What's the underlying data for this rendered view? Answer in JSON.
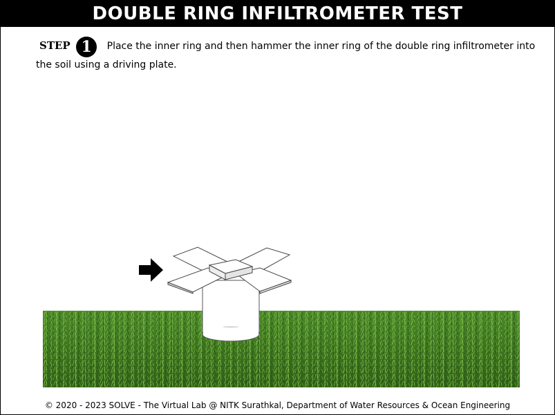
{
  "header": {
    "title": "DOUBLE RING INFILTROMETER TEST"
  },
  "step": {
    "label": "STEP",
    "number": "1",
    "text": "Place the inner ring and then hammer the inner ring of the double ring infiltrometer into the soil using a driving plate."
  },
  "scene": {
    "arrow_icon": "right-arrow-icon",
    "grass_color": "#3f7a1f"
  },
  "footer": {
    "text": "© 2020 - 2023 SOLVE - The Virtual Lab @ NITK Surathkal, Department of Water Resources & Ocean Engineering"
  }
}
